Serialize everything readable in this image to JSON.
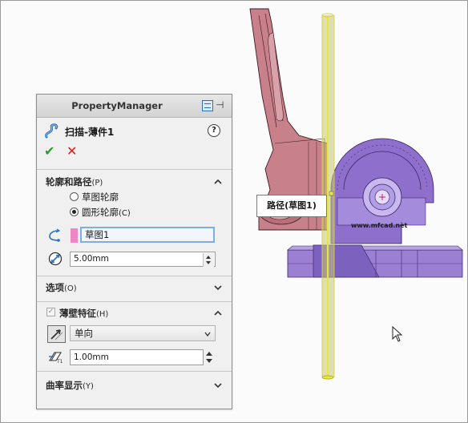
{
  "viewport": {
    "path_label": "路径(草图1)",
    "watermark": "www.mfcad.net"
  },
  "property_manager": {
    "title": "PropertyManager",
    "feature_name": "扫描-薄件1",
    "help_glyph": "?",
    "ok_glyph": "✔",
    "cancel_glyph": "✕",
    "sections": {
      "profile_path": {
        "title": "轮廓和路径",
        "accel": "(P)",
        "radio_sketch_profile": "草图轮廓",
        "radio_circular_profile": "圆形轮廓",
        "radio_circular_accel": "(C)",
        "selected_radio": "circular_profile",
        "path_selection": "草图1",
        "diameter": "5.00mm"
      },
      "options": {
        "title": "选项",
        "accel": "(O)"
      },
      "thin_feature": {
        "title": "薄壁特征",
        "accel": "(H)",
        "checked": true,
        "type": "单向",
        "thickness": "1.00mm"
      },
      "curvature": {
        "title": "曲率显示",
        "accel": "(Y)"
      }
    }
  },
  "colors": {
    "accent_blue": "#2a6fb8",
    "selection_pink": "#ee86c4",
    "ok_green": "#2e9a2e",
    "cancel_red": "#d02020",
    "path_yellow": "#e6e63c",
    "part_purple": "#8a68c8",
    "part_pink": "#c77a86"
  },
  "icons": [
    "sweep-feature-icon",
    "help-icon",
    "ok-icon",
    "cancel-icon",
    "profile-path-icon",
    "diameter-icon",
    "reverse-direction-icon",
    "thickness-icon",
    "chevron-up-icon",
    "chevron-down-icon",
    "pushpin-icon",
    "mouse-cursor-icon"
  ]
}
